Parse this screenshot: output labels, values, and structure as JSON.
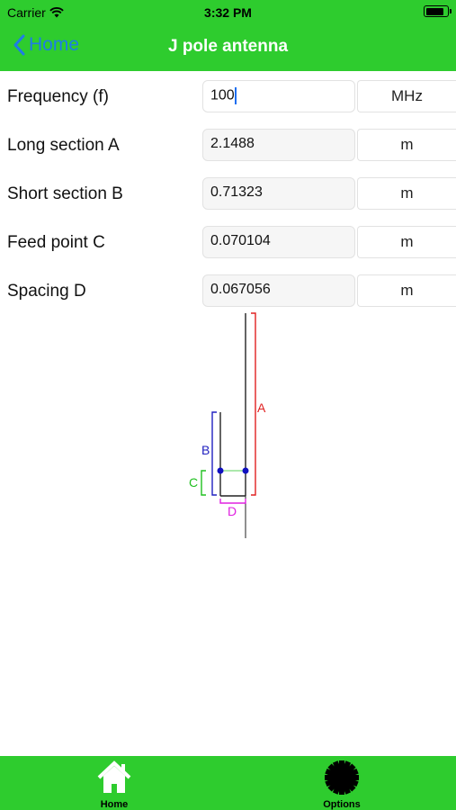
{
  "status": {
    "carrier": "Carrier",
    "time": "3:32 PM",
    "battery_level": 0.85
  },
  "nav": {
    "back_label": "Home",
    "title": "J pole antenna"
  },
  "rows": [
    {
      "label": "Frequency (f)",
      "value": "100",
      "unit": "MHz",
      "editing": true
    },
    {
      "label": "Long section A",
      "value": "2.1488",
      "unit": "m"
    },
    {
      "label": "Short section B",
      "value": "0.71323",
      "unit": "m"
    },
    {
      "label": "Feed point C",
      "value": "0.070104",
      "unit": "m"
    },
    {
      "label": "Spacing D",
      "value": "0.067056",
      "unit": "m"
    }
  ],
  "diagram": {
    "labels": {
      "A": "A",
      "B": "B",
      "C": "C",
      "D": "D"
    },
    "colors": {
      "A": "#e02020",
      "B": "#2020c0",
      "C": "#20c020",
      "D": "#e020e0",
      "antenna": "#222222",
      "feed_dots": "#1010c0"
    }
  },
  "tabs": [
    {
      "label": "Home",
      "icon": "home-icon",
      "selected": true
    },
    {
      "label": "Options",
      "icon": "gear-icon",
      "selected": false
    }
  ],
  "colors": {
    "bar_green": "#2ecc2e",
    "link_blue": "#1e7ce6"
  }
}
